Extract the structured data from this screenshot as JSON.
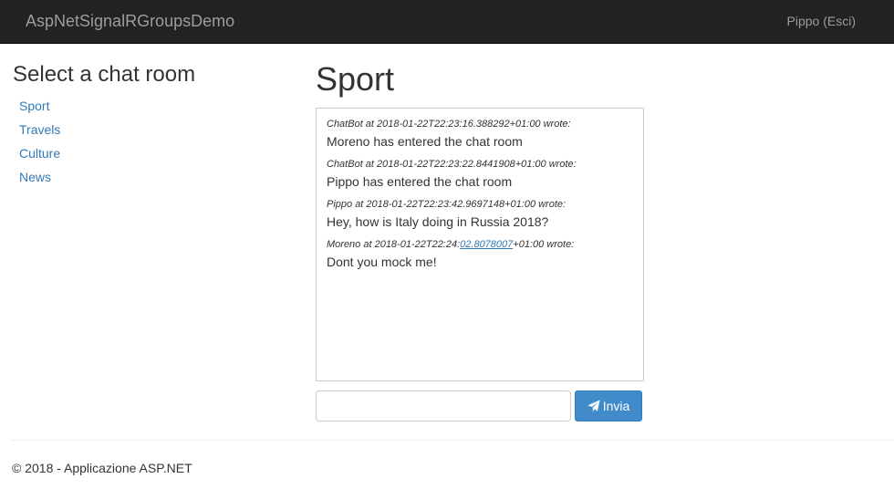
{
  "navbar": {
    "brand": "AspNetSignalRGroupsDemo",
    "user": "Pippo (Esci)"
  },
  "sidebar": {
    "title": "Select a chat room",
    "rooms": [
      "Sport",
      "Travels",
      "Culture",
      "News"
    ]
  },
  "main": {
    "room_title": "Sport",
    "messages": [
      {
        "meta": "ChatBot at 2018-01-22T22:23:16.388292+01:00 wrote:",
        "text": "Moreno has entered the chat room"
      },
      {
        "meta": "ChatBot at 2018-01-22T22:23:22.8441908+01:00 wrote:",
        "text": "Pippo has entered the chat room"
      },
      {
        "meta": "Pippo at 2018-01-22T22:23:42.9697148+01:00 wrote:",
        "text": "Hey, how is Italy doing in Russia 2018?"
      },
      {
        "meta_prefix": "Moreno at 2018-01-22T22:24:",
        "meta_link": "02.8078007",
        "meta_suffix": "+01:00 wrote:",
        "text": "Dont you mock me!"
      }
    ],
    "input_value": "",
    "send_label": "Invia",
    "send_icon": "paper-plane-icon"
  },
  "footer": {
    "text": "© 2018 - Applicazione ASP.NET"
  },
  "colors": {
    "navbar_bg": "#222222",
    "link": "#337ab7",
    "button": "#428bca"
  }
}
